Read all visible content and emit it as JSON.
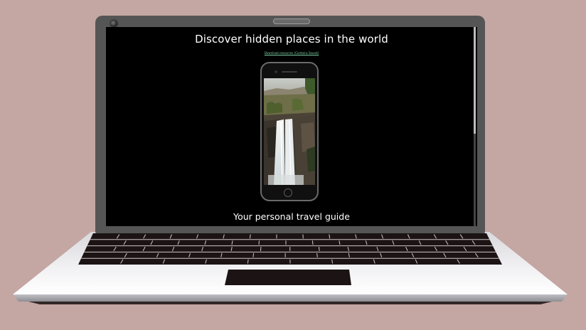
{
  "page": {
    "title": "Discover hidden places in the world",
    "download_link": "Download resources (Contains Sound)",
    "subtitle": "Your personal travel guide"
  },
  "colors": {
    "background": "#c4a6a2",
    "screen": "#000000",
    "link": "#7fd1a8",
    "text": "#ffffff"
  },
  "images": {
    "phone_screen": "waterfall-canyon-video"
  }
}
